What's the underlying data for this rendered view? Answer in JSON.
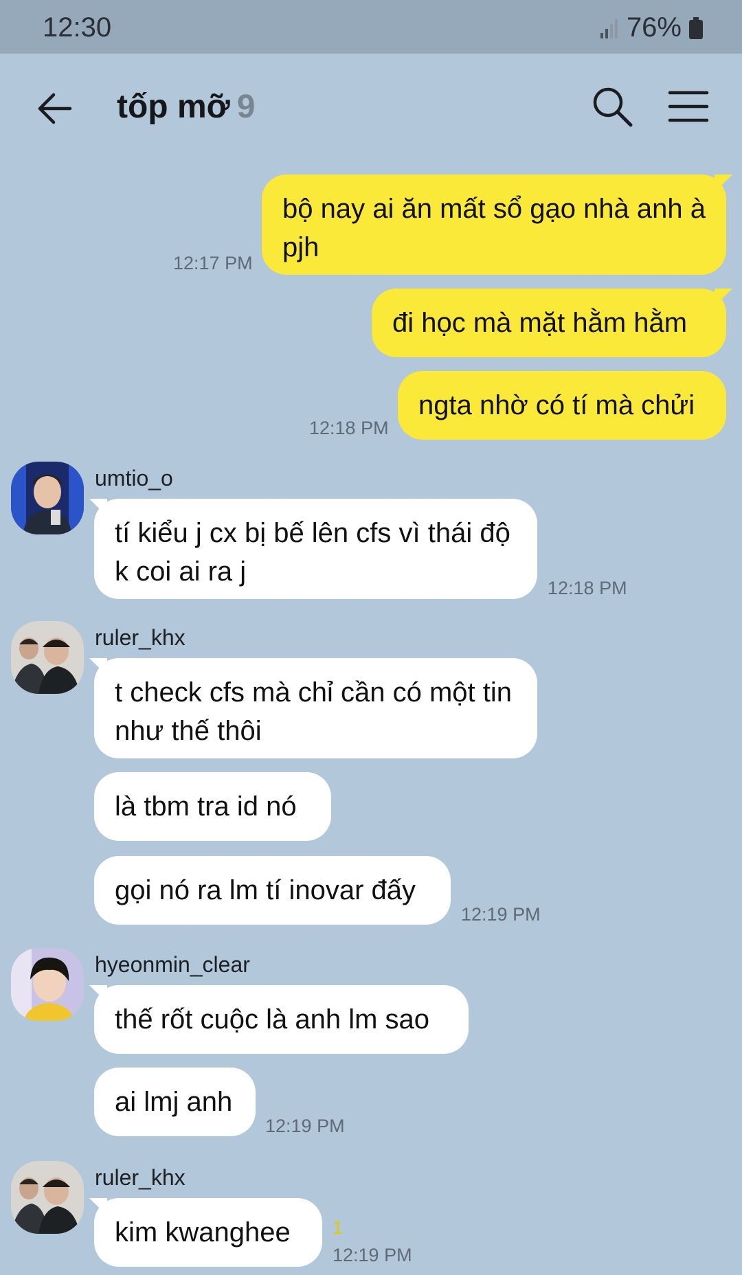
{
  "status_bar": {
    "time": "12:30",
    "battery": "76%"
  },
  "header": {
    "title": "tốp mỡ",
    "member_count": "9"
  },
  "messages": {
    "m1": {
      "text": "bộ nay ai ăn mất sổ gạo nhà anh à pjh",
      "time": "12:17 PM"
    },
    "m2": {
      "text": "đi học mà mặt hằm hằm"
    },
    "m3": {
      "text": "ngta nhờ có tí mà chửi",
      "time": "12:18 PM"
    },
    "g1": {
      "sender": "umtio_o",
      "text": "tí kiểu j cx bị bế lên cfs vì thái độ k coi ai ra j",
      "time": "12:18 PM"
    },
    "g2": {
      "sender": "ruler_khx",
      "text1": "t check cfs mà chỉ cần có một tin như thế thôi",
      "text2": "là tbm tra id nó",
      "text3": "gọi nó ra lm tí inovar đấy",
      "time": "12:19 PM"
    },
    "g3": {
      "sender": "hyeonmin_clear",
      "text1": "thế rốt cuộc là anh lm sao",
      "text2": "ai lmj anh",
      "time": "12:19 PM"
    },
    "g4": {
      "sender": "ruler_khx",
      "text": "kim kwanghee",
      "unread": "1",
      "time": "12:19 PM"
    }
  },
  "colors": {
    "background": "#b2c7da",
    "my_bubble": "#fbe93a",
    "other_bubble": "#ffffff",
    "status_bar": "#96a9bb"
  }
}
